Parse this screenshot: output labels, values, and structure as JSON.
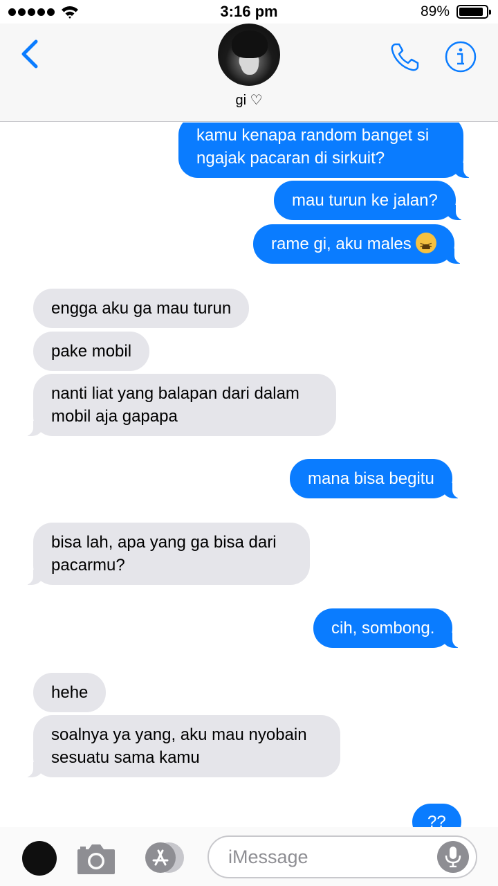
{
  "status": {
    "time": "3:16 pm",
    "battery_pct": "89%",
    "battery_level": 0.89
  },
  "header": {
    "contact_name": "gi ♡",
    "icons": [
      "back-chevron-icon",
      "phone-icon",
      "info-icon"
    ]
  },
  "messages": [
    {
      "from": "me",
      "text": "kamu kenapa random banget si ngajak pacaran di sirkuit?"
    },
    {
      "from": "me",
      "text": "mau turun ke jalan?"
    },
    {
      "from": "me",
      "text": "rame gi, aku males",
      "emoji": "tired-face-emoji"
    },
    {
      "from": "them",
      "text": "engga aku ga mau turun"
    },
    {
      "from": "them",
      "text": "pake mobil"
    },
    {
      "from": "them",
      "text": "nanti liat yang balapan dari dalam mobil aja gapapa"
    },
    {
      "from": "me",
      "text": "mana bisa begitu"
    },
    {
      "from": "them",
      "text": "bisa lah, apa yang ga bisa dari pacarmu?"
    },
    {
      "from": "me",
      "text": "cih, sombong."
    },
    {
      "from": "them",
      "text": "hehe"
    },
    {
      "from": "them",
      "text": "soalnya ya yang, aku mau nyobain sesuatu sama kamu"
    },
    {
      "from": "me",
      "text": "??"
    }
  ],
  "input": {
    "placeholder": "iMessage"
  },
  "colors": {
    "sent_bubble": "#0a7cff",
    "received_bubble": "#e5e5ea",
    "accent": "#0a7cff"
  }
}
